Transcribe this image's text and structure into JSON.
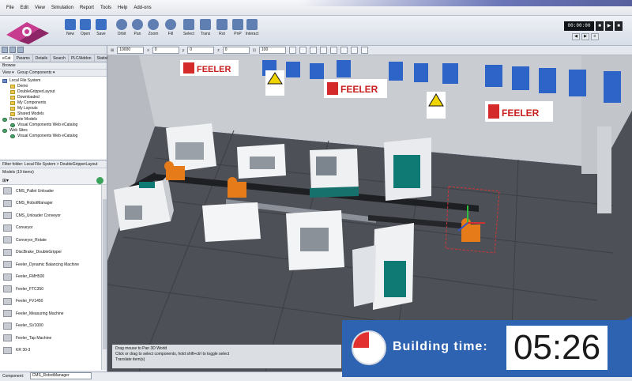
{
  "menu": [
    "File",
    "Edit",
    "View",
    "Simulation",
    "Report",
    "Tools",
    "Help",
    "Add-ons"
  ],
  "toolbar": {
    "buttons": [
      {
        "label": "New",
        "icon": "new-file-icon"
      },
      {
        "label": "Open",
        "icon": "open-folder-icon"
      },
      {
        "label": "Save",
        "icon": "save-icon"
      },
      {
        "label": "Orbit",
        "icon": "orbit-icon"
      },
      {
        "label": "Pan",
        "icon": "pan-icon"
      },
      {
        "label": "Zoom",
        "icon": "zoom-icon"
      },
      {
        "label": "Fill",
        "icon": "fill-icon"
      },
      {
        "label": "Select",
        "icon": "select-icon"
      },
      {
        "label": "Trans",
        "icon": "translate-icon"
      },
      {
        "label": "Rot",
        "icon": "rotate-icon"
      },
      {
        "label": "PnP",
        "icon": "plug-and-play-icon"
      },
      {
        "label": "Interact",
        "icon": "interact-icon"
      }
    ],
    "sim_time": "00:00:00"
  },
  "grid_bar": {
    "grid_size": "10000",
    "x_value": "0",
    "y_value": "0",
    "z_value": "0",
    "snap_value": "100"
  },
  "left_panel": {
    "tabs": [
      "eCat",
      "Params",
      "Details",
      "Search",
      "PLC/Addon",
      "Statist"
    ],
    "browse_label": "Browse",
    "view_label": "View",
    "group_label": "Group Components",
    "tree": [
      {
        "label": "Local File System",
        "level": 0,
        "icon": "pc"
      },
      {
        "label": "Demo",
        "level": 1,
        "icon": "folder"
      },
      {
        "label": "DoubleGripperLayout",
        "level": 1,
        "icon": "folder"
      },
      {
        "label": "Downloaded",
        "level": 1,
        "icon": "folder"
      },
      {
        "label": "My Components",
        "level": 1,
        "icon": "folder"
      },
      {
        "label": "My Layouts",
        "level": 1,
        "icon": "folder"
      },
      {
        "label": "Shared Models",
        "level": 1,
        "icon": "folder"
      },
      {
        "label": "Remote Models",
        "level": 0,
        "icon": "globe"
      },
      {
        "label": "Visual Components Web eCatalog",
        "level": 1,
        "icon": "globe"
      },
      {
        "label": "Web Sites",
        "level": 0,
        "icon": "globe"
      },
      {
        "label": "Visual Components Web eCatalog",
        "level": 1,
        "icon": "globe"
      }
    ],
    "path": "Filter folder: Local File System > DoubleGripperLayout",
    "models_count": "Models (19 items)",
    "models": [
      "CMS_Pallet Unloader",
      "CMS_RobotManager",
      "CMS_Unloader Conveyor",
      "Conveyor",
      "Conveyor_Rotate",
      "DiscBrake_DoubleGripper",
      "Feeler_Dynamic Balancing Machine",
      "Feeler_FMH500",
      "Feeler_FTC350",
      "Feeler_FV1450",
      "Feeler_Measuring Machine",
      "Feeler_SV1000",
      "Feeler_Tap Machine",
      "KR 30-3"
    ],
    "component_label": "Component:",
    "component_value": "CMS_RobotManager"
  },
  "viewport": {
    "brand_signs": [
      "FEELER",
      "FEELER",
      "FEELER"
    ]
  },
  "status": {
    "line1": "Drag mouse to Pan 3D World",
    "line2": "Click or drag to select components, hold shift+ctrl to toggle select",
    "line3": "Translate item(s)"
  },
  "overlay": {
    "label": "Building time:",
    "time": "05:26"
  }
}
